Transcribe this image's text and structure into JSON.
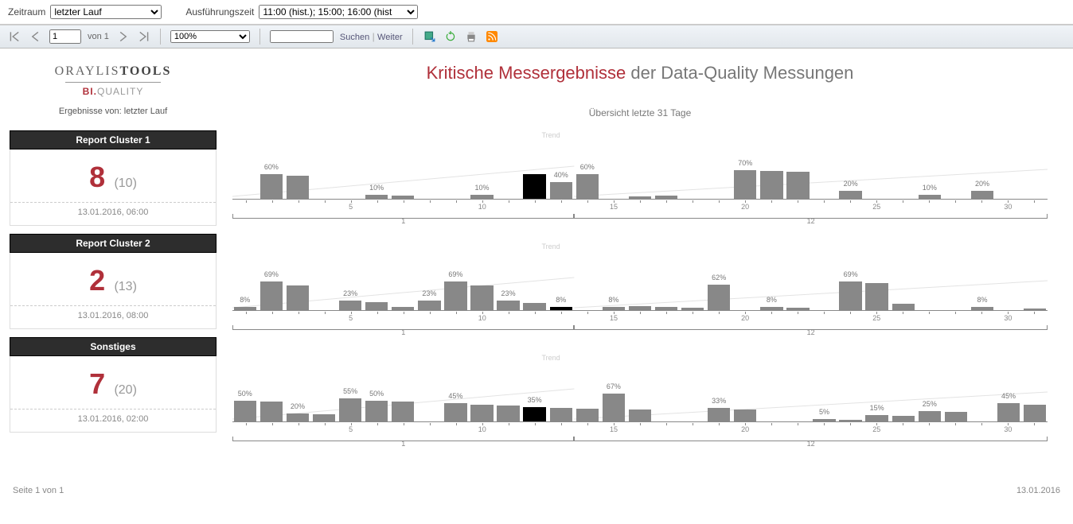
{
  "filter": {
    "zeitraum_label": "Zeitraum",
    "zeitraum_value": "letzter Lauf",
    "ausfuehrung_label": "Ausführungszeit",
    "ausfuehrung_value": "11:00 (hist.); 15:00; 16:00 (hist"
  },
  "toolbar": {
    "page_value": "1",
    "page_of": "von 1",
    "zoom_value": "100%",
    "search_placeholder": "",
    "search_label": "Suchen",
    "next_label": "Weiter"
  },
  "brand": {
    "line1a": "ORAYLIS",
    "line1b": "TOOLS",
    "line2a": "BI.",
    "line2b": "QUALITY"
  },
  "ergebnis": "Ergebnisse von: letzter Lauf",
  "clusters": [
    {
      "title": "Report Cluster 1",
      "big": "8",
      "small": "(10)",
      "date": "13.01.2016, 06:00"
    },
    {
      "title": "Report Cluster 2",
      "big": "2",
      "small": "(13)",
      "date": "13.01.2016, 08:00"
    },
    {
      "title": "Sonstiges",
      "big": "7",
      "small": "(20)",
      "date": "13.01.2016, 02:00"
    }
  ],
  "main_title_red": "Kritische Messergebnisse",
  "main_title_rest": " der Data-Quality Messungen",
  "subtitle": "Übersicht letzte 31 Tage",
  "chart_data": [
    {
      "type": "bar",
      "xlabel": "",
      "ylabel": "",
      "ylim": [
        0,
        100
      ],
      "categories": [
        1,
        2,
        3,
        4,
        5,
        6,
        7,
        8,
        9,
        10,
        11,
        12,
        13,
        14,
        15,
        16,
        17,
        18,
        19,
        20,
        21,
        22,
        23,
        24,
        25,
        26,
        27,
        28,
        29,
        30,
        31
      ],
      "tick_every": 5,
      "month_split": {
        "first": "1",
        "second": "12",
        "split_at": 13
      },
      "values": [
        null,
        60,
        55,
        null,
        null,
        10,
        8,
        null,
        null,
        10,
        null,
        60,
        40,
        60,
        null,
        6,
        8,
        null,
        null,
        70,
        68,
        66,
        null,
        20,
        null,
        null,
        10,
        null,
        20,
        null,
        null
      ],
      "highlight_index": 11,
      "label_at": {
        "1": "60%",
        "5": "10%",
        "9": "10%",
        "12": "40%",
        "13": "60%",
        "19": "70%",
        "23": "20%",
        "26": "10%",
        "28": "20%"
      },
      "trend": "Trend"
    },
    {
      "type": "bar",
      "ylim": [
        0,
        100
      ],
      "tick_every": 5,
      "categories": [
        1,
        2,
        3,
        4,
        5,
        6,
        7,
        8,
        9,
        10,
        11,
        12,
        13,
        14,
        15,
        16,
        17,
        18,
        19,
        20,
        21,
        22,
        23,
        24,
        25,
        26,
        27,
        28,
        29,
        30,
        31
      ],
      "month_split": {
        "first": "1",
        "second": "12",
        "split_at": 13
      },
      "values": [
        8,
        69,
        60,
        null,
        23,
        20,
        8,
        23,
        69,
        60,
        23,
        18,
        8,
        null,
        8,
        10,
        8,
        6,
        62,
        null,
        8,
        6,
        null,
        69,
        65,
        15,
        null,
        null,
        8,
        null,
        4
      ],
      "highlight_index": 12,
      "label_at": {
        "0": "8%",
        "1": "69%",
        "4": "23%",
        "7": "23%",
        "8": "69%",
        "10": "23%",
        "12": "8%",
        "14": "8%",
        "18": "62%",
        "20": "8%",
        "23": "69%",
        "28": "8%"
      },
      "trend": "Trend"
    },
    {
      "type": "bar",
      "ylim": [
        0,
        100
      ],
      "tick_every": 5,
      "categories": [
        1,
        2,
        3,
        4,
        5,
        6,
        7,
        8,
        9,
        10,
        11,
        12,
        13,
        14,
        15,
        16,
        17,
        18,
        19,
        20,
        21,
        22,
        23,
        24,
        25,
        26,
        27,
        28,
        29,
        30,
        31
      ],
      "month_split": {
        "first": "1",
        "second": "12",
        "split_at": 13
      },
      "values": [
        50,
        48,
        20,
        18,
        55,
        50,
        48,
        null,
        45,
        40,
        38,
        35,
        33,
        30,
        67,
        28,
        null,
        null,
        33,
        28,
        null,
        null,
        5,
        4,
        15,
        13,
        25,
        23,
        null,
        45,
        40
      ],
      "highlight_index": 11,
      "label_at": {
        "0": "50%",
        "2": "20%",
        "4": "55%",
        "5": "50%",
        "8": "45%",
        "11": "35%",
        "14": "67%",
        "18": "33%",
        "22": "5%",
        "24": "15%",
        "26": "25%",
        "29": "45%"
      },
      "trend": "Trend"
    }
  ],
  "footer": {
    "left": "Seite 1 von 1",
    "right": "13.01.2016"
  }
}
